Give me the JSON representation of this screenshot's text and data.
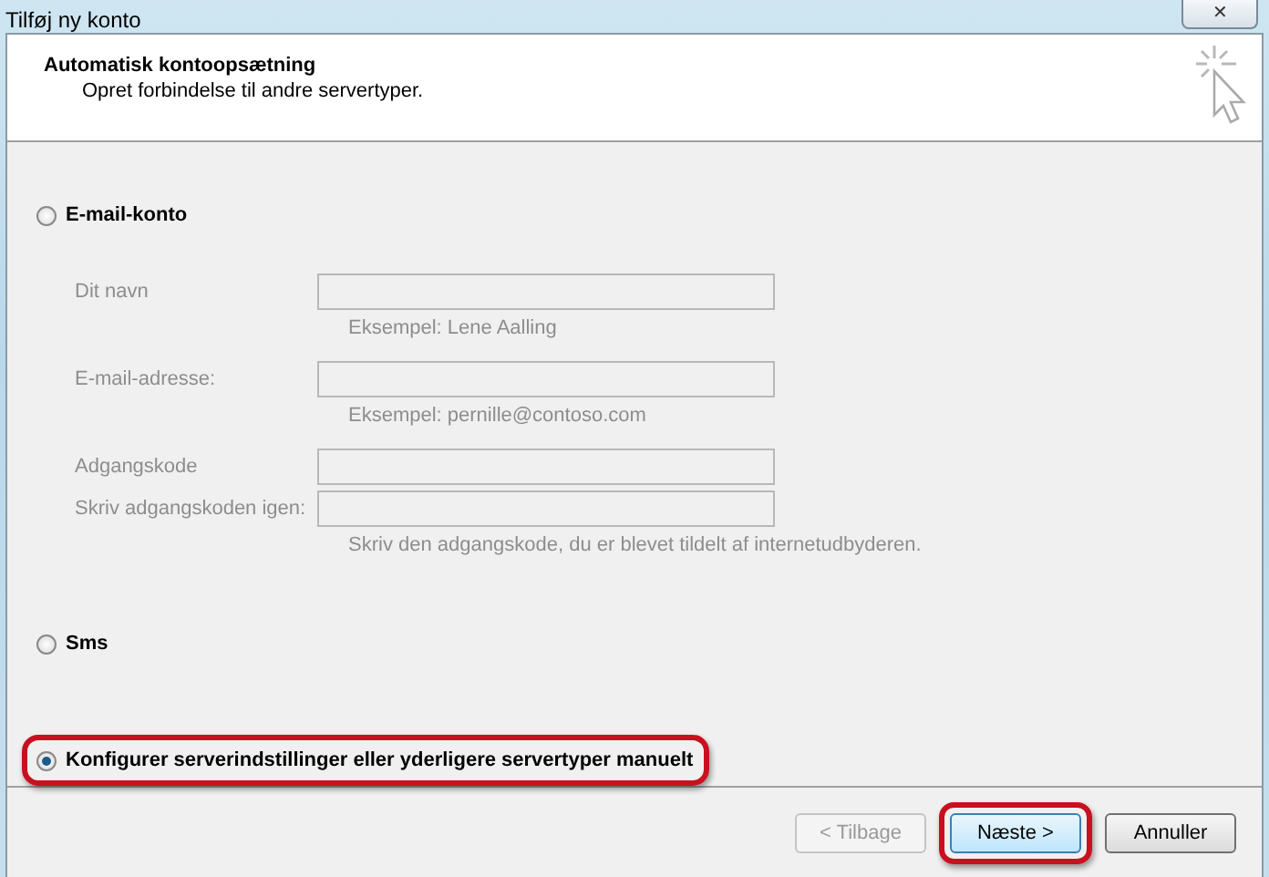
{
  "window": {
    "title": "Tilføj ny konto",
    "close": "✕"
  },
  "header": {
    "title": "Automatisk kontoopsætning",
    "subtitle": "Opret forbindelse til andre servertyper."
  },
  "options": [
    {
      "label": "E-mail-konto",
      "selected": false,
      "highlighted": false,
      "fields": [
        {
          "label": "Dit navn",
          "hint": "Eksempel: Lene Aalling",
          "disabled": true
        },
        {
          "label": "E-mail-adresse:",
          "hint": "Eksempel: pernille@contoso.com",
          "disabled": true
        },
        {
          "label": "Adgangskode",
          "disabled": true
        },
        {
          "label": "Skriv adgangskoden igen:",
          "hint": "Skriv den adgangskode, du er blevet tildelt af internetudbyderen.",
          "disabled": true
        }
      ]
    },
    {
      "label": "Sms",
      "selected": false,
      "highlighted": false
    },
    {
      "label": "Konfigurer serverindstillinger eller yderligere servertyper manuelt",
      "selected": true,
      "highlighted": true
    }
  ],
  "buttons": [
    {
      "label": "< Tilbage",
      "disabled": true,
      "highlighted": false,
      "default": false
    },
    {
      "label": "Næste >",
      "disabled": false,
      "highlighted": true,
      "default": true
    },
    {
      "label": "Annuller",
      "disabled": false,
      "highlighted": false,
      "default": false
    }
  ]
}
